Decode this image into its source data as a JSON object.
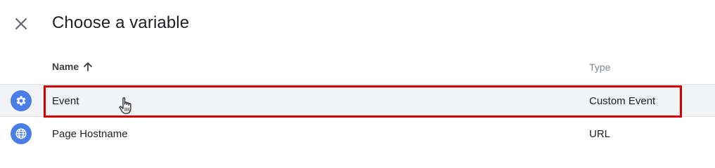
{
  "dialog": {
    "title": "Choose a variable"
  },
  "columns": {
    "name_label": "Name",
    "sort_icon": "arrow-up-icon",
    "type_label": "Type"
  },
  "rows": [
    {
      "name": "Event",
      "type": "Custom Event",
      "icon": "gear-icon",
      "selected": true
    },
    {
      "name": "Page Hostname",
      "type": "URL",
      "icon": "globe-icon",
      "selected": false
    }
  ],
  "colors": {
    "highlight": "#d50000",
    "icon_bg": "#4a7ee6",
    "selected_row_bg": "#f1f3f4"
  }
}
